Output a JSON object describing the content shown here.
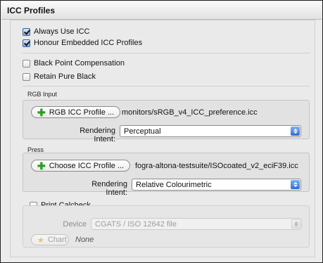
{
  "panel": {
    "title": "ICC Profiles"
  },
  "options": {
    "always_use_icc": {
      "label": "Always Use ICC",
      "checked": true
    },
    "honour_embedded": {
      "label": "Honour Embedded ICC Profiles",
      "checked": true
    },
    "black_point": {
      "label": "Black Point Compensation",
      "checked": false
    },
    "retain_black": {
      "label": "Retain Pure Black",
      "checked": false
    }
  },
  "rgb_input": {
    "section_label": "RGB Input",
    "button_label": "RGB ICC Profile ...",
    "profile_path": "monitors/sRGB_v4_ICC_preference.icc",
    "intent_label": "Rendering Intent:",
    "intent_value": "Perceptual"
  },
  "press": {
    "section_label": "Press",
    "button_label": "Choose ICC Profile ...",
    "profile_path": "fogra-altona-testsuite/ISOcoated_v2_eciF39.icc",
    "intent_label": "Rendering Intent:",
    "intent_value": "Relative Colourimetric"
  },
  "calcheck": {
    "label": "Print Calcheck",
    "checked": false,
    "device_label": "Device",
    "device_value": "CGATS / ISO 12642 file",
    "chart_button": "Chart",
    "chart_value": "None"
  },
  "icons": {
    "add": "plus-icon",
    "chart": "star-icon",
    "popup": "updown-arrows-icon"
  },
  "colors": {
    "plus": "#27a01f",
    "popup_arrow": "#2f6fd0"
  }
}
